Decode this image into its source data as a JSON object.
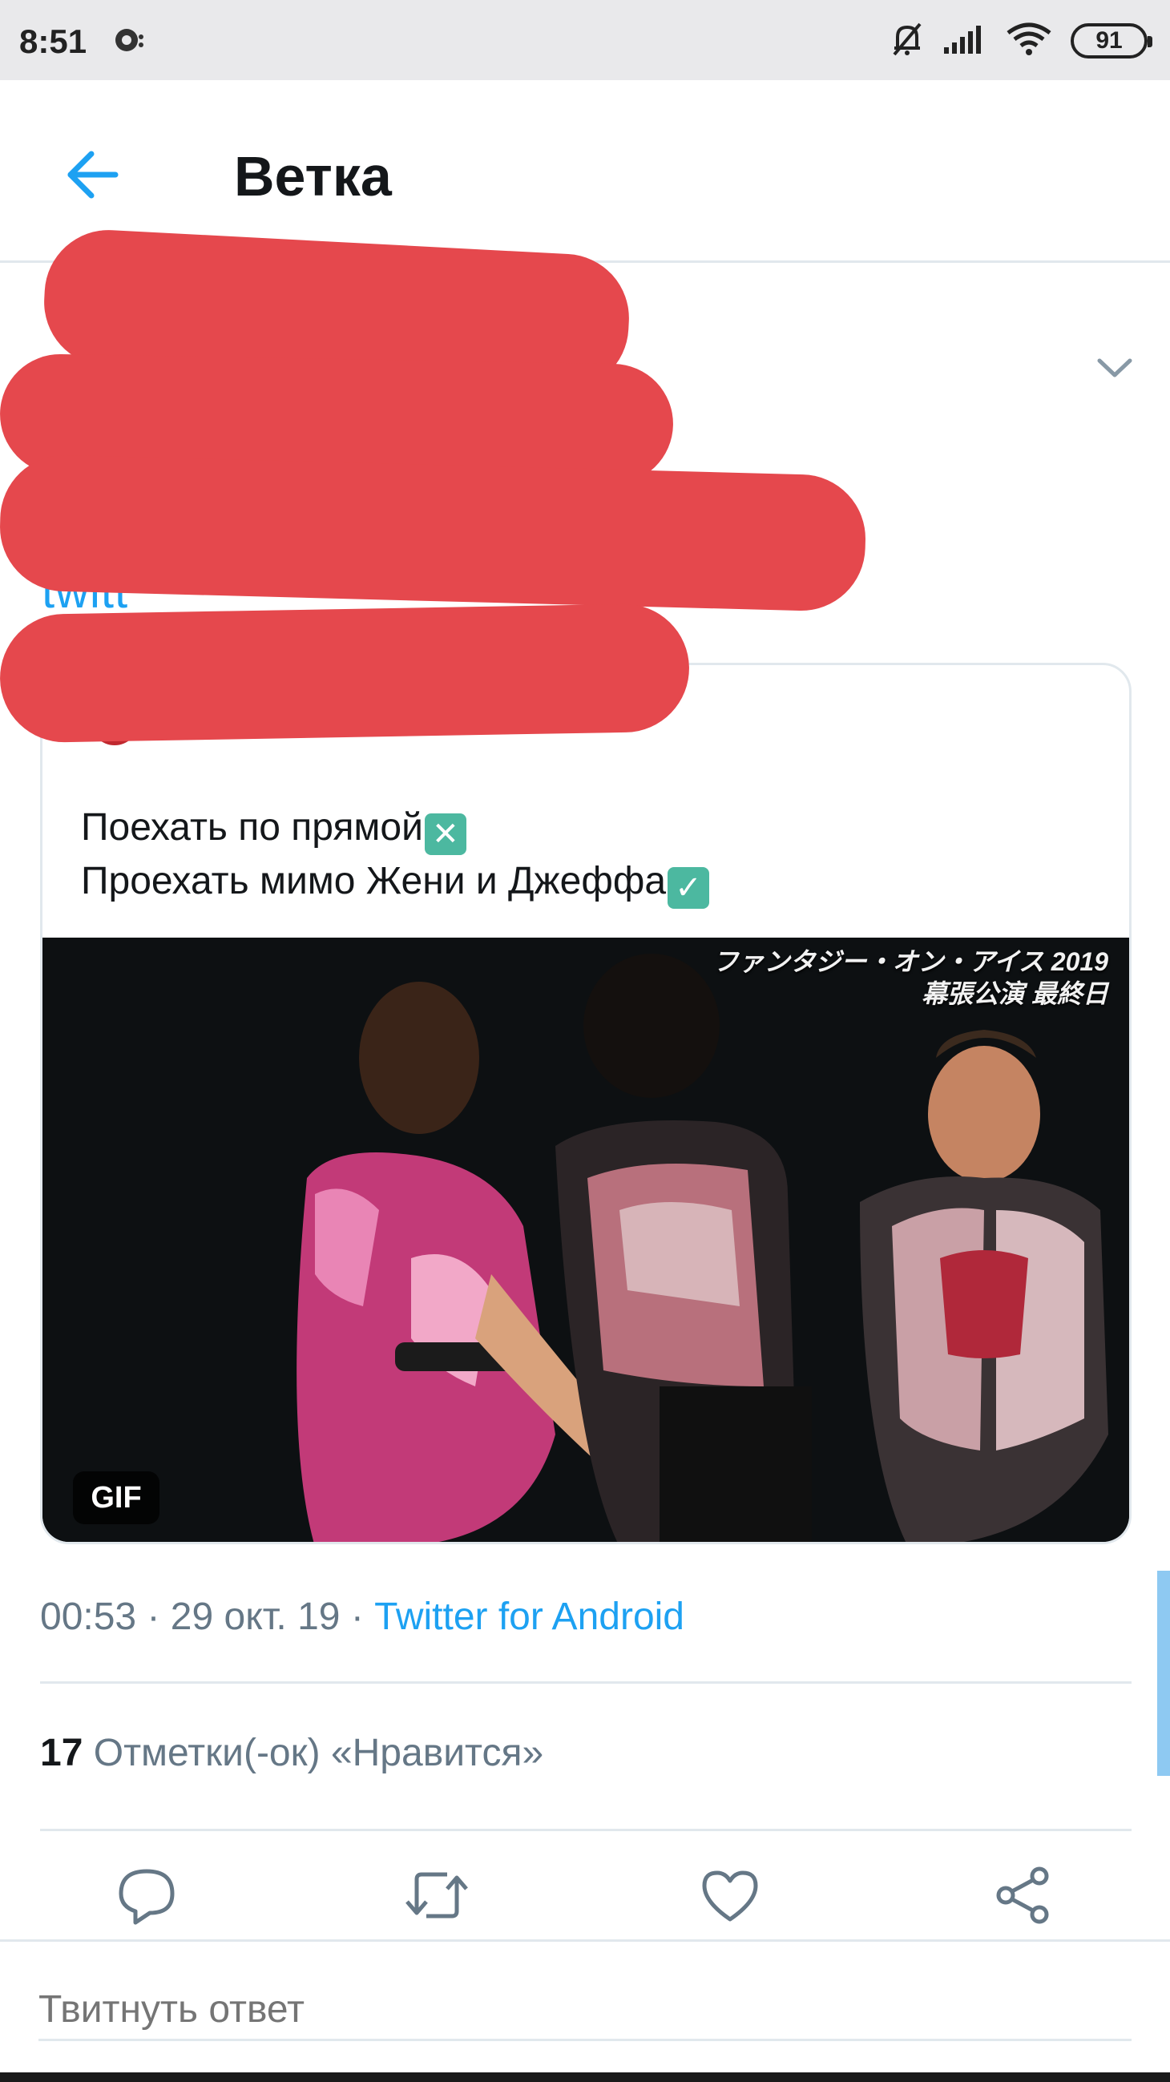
{
  "status_bar": {
    "time": "8:51",
    "battery": "91",
    "icons": [
      "notification-icon",
      "mute-icon",
      "signal-icon",
      "wifi-icon",
      "battery-icon"
    ]
  },
  "header": {
    "title": "Ветка",
    "back_icon": "arrow-left-icon"
  },
  "tweet": {
    "author_redacted": true,
    "visible_link_fragment": "twitt",
    "caret_icon": "chevron-down-icon",
    "quoted_tweet": {
      "line1": "Поехать по прямой",
      "line1_emoji": "cross-mark-emoji",
      "line2": "Проехать мимо Жени и Джеффа",
      "line2_emoji": "check-mark-emoji",
      "media": {
        "type": "GIF",
        "badge": "GIF",
        "caption_line1": "ファンタジー・オン・アイス 2019",
        "caption_line2": "幕張公演 最終日"
      }
    },
    "meta": {
      "time": "00:53",
      "date": "29 окт. 19",
      "separator": "·",
      "source": "Twitter for Android"
    },
    "likes": {
      "count": "17",
      "label": "Отметки(-ок) «Нравится»"
    },
    "actions": [
      {
        "name": "reply-icon"
      },
      {
        "name": "retweet-icon"
      },
      {
        "name": "like-icon"
      },
      {
        "name": "share-icon"
      }
    ]
  },
  "reply_bar": {
    "placeholder": "Твитнуть ответ"
  },
  "colors": {
    "accent": "#1da1f2",
    "redaction": "#e5484d",
    "secondary_text": "#657786",
    "divider": "#e1e8ed"
  }
}
